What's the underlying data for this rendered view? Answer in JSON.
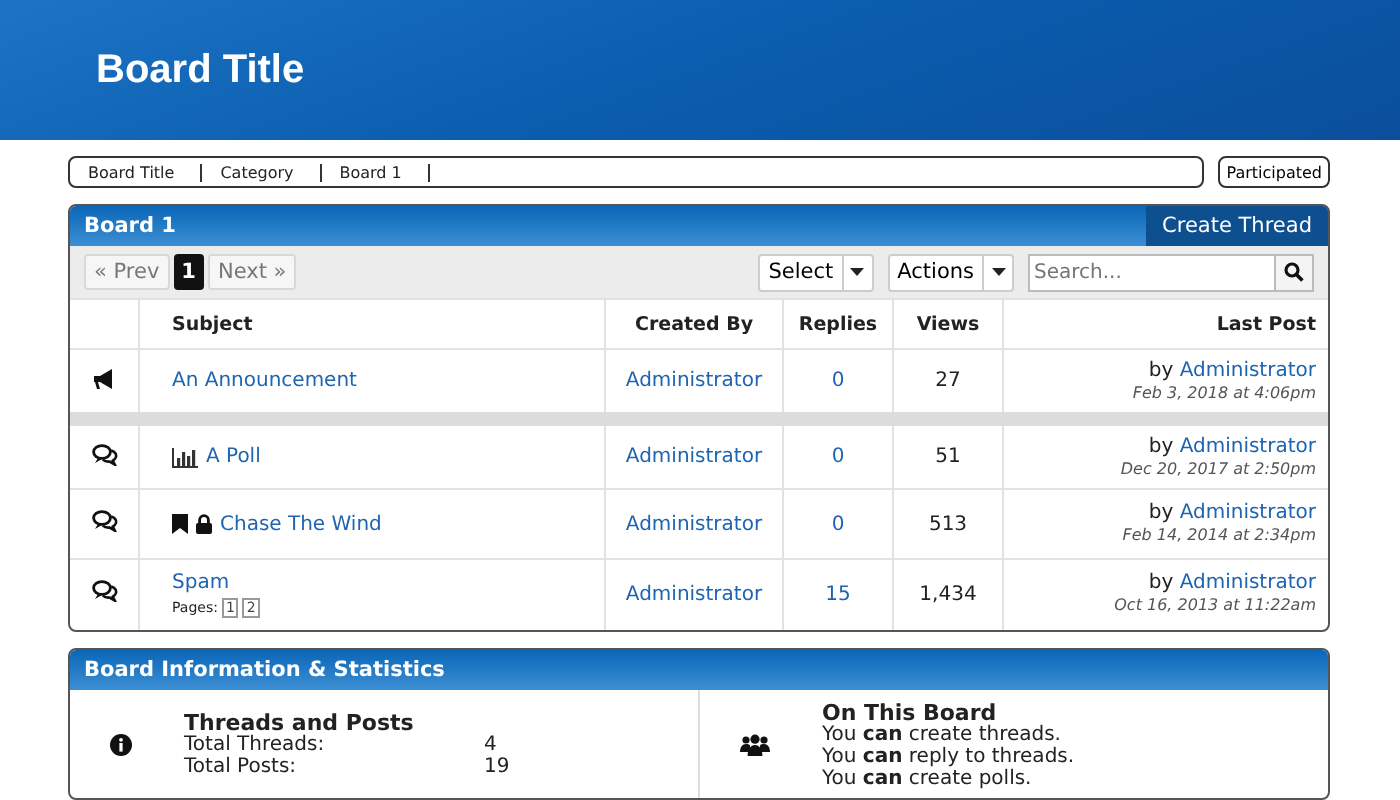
{
  "header": {
    "title": "Board Title"
  },
  "breadcrumb": [
    "Board Title",
    "Category",
    "Board 1"
  ],
  "participated_button": "Participated",
  "board": {
    "title": "Board 1",
    "create_button": "Create Thread",
    "pagination": {
      "prev": "« Prev",
      "pages": [
        {
          "label": "1",
          "selected": true
        }
      ],
      "next": "Next »"
    },
    "select_button": "Select",
    "actions_button": "Actions",
    "search": {
      "placeholder": "Search..."
    },
    "columns": [
      "Subject",
      "Created By",
      "Replies",
      "Views",
      "Last Post"
    ],
    "sections": [
      {
        "rows": [
          {
            "kind": "announcement",
            "poll": false,
            "bookmarked": false,
            "locked": false,
            "subject": "An Announcement",
            "pages": [],
            "created_by": "Administrator",
            "replies": "0",
            "views": "27",
            "last_by": "by",
            "last_author": "Administrator",
            "last_date": "Feb 3, 2018 at 4:06pm"
          }
        ]
      },
      {
        "rows": [
          {
            "kind": "thread",
            "poll": true,
            "bookmarked": false,
            "locked": false,
            "subject": "A Poll",
            "pages": [],
            "created_by": "Administrator",
            "replies": "0",
            "views": "51",
            "last_by": "by",
            "last_author": "Administrator",
            "last_date": "Dec 20, 2017 at 2:50pm"
          },
          {
            "kind": "thread",
            "poll": false,
            "bookmarked": true,
            "locked": true,
            "subject": "Chase The Wind",
            "pages": [],
            "created_by": "Administrator",
            "replies": "0",
            "views": "513",
            "last_by": "by",
            "last_author": "Administrator",
            "last_date": "Feb 14, 2014 at 2:34pm"
          },
          {
            "kind": "thread",
            "poll": false,
            "bookmarked": false,
            "locked": false,
            "subject": "Spam",
            "pages_label": "Pages:",
            "pages": [
              "1",
              "2"
            ],
            "created_by": "Administrator",
            "replies": "15",
            "views": "1,434",
            "last_by": "by",
            "last_author": "Administrator",
            "last_date": "Oct 16, 2013 at 11:22am"
          }
        ]
      }
    ]
  },
  "info": {
    "title": "Board Information & Statistics",
    "stats": {
      "heading": "Threads and Posts",
      "items": [
        {
          "label": "Total Threads:",
          "value": "4"
        },
        {
          "label": "Total Posts:",
          "value": "19"
        }
      ]
    },
    "permissions": {
      "heading": "On This Board",
      "lines": [
        "You **can** create threads.",
        "You **can** reply to threads.",
        "You **can** create polls."
      ]
    }
  }
}
